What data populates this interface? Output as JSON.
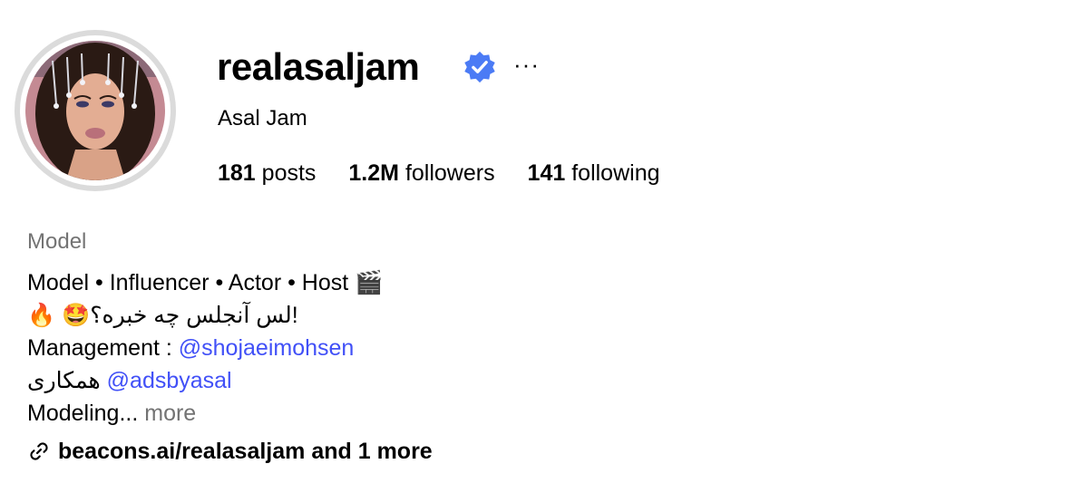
{
  "profile": {
    "username": "realasaljam",
    "verified_icon": "verified-badge-icon",
    "verified_color": "#4b7bf5",
    "more_icon": "more-options-icon",
    "more_glyph": "···",
    "full_name": "Asal Jam"
  },
  "stats": {
    "posts_count": "181",
    "posts_label": "posts",
    "followers_count": "1.2M",
    "followers_label": "followers",
    "following_count": "141",
    "following_label": "following"
  },
  "bio": {
    "category": "Model",
    "line1": "Model • Influencer • Actor • Host 🎬",
    "line2": "!لس آنجلس چه خبره؟🤩 🔥",
    "line3_prefix": "Management : ",
    "line3_mention": "@shojaeimohsen",
    "line4_text": "همکاری",
    "line4_mention": "@adsbyasal",
    "line5_text": "Modeling...",
    "line5_more": "more"
  },
  "link": {
    "icon": "link-icon",
    "text": "beacons.ai/realasaljam and 1 more"
  },
  "colors": {
    "mention": "#4150f7",
    "secondary_text": "#737373",
    "ring": "#dbdbdb"
  }
}
